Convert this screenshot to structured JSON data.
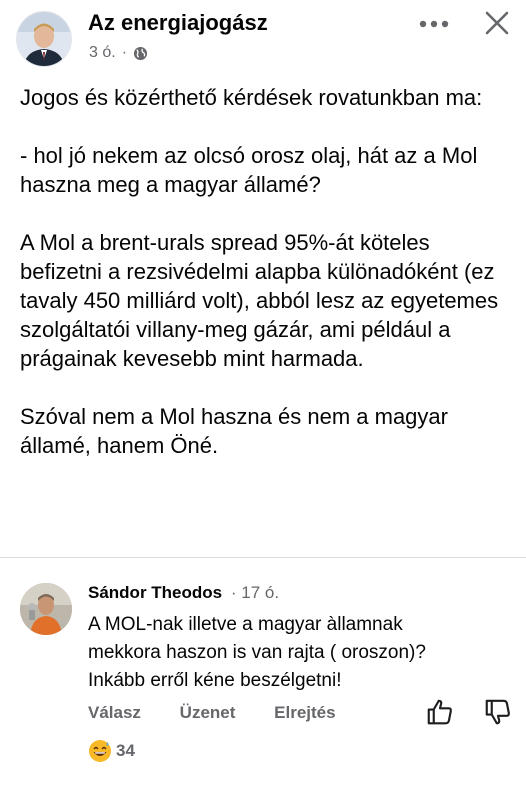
{
  "post": {
    "author": "Az energiajogász",
    "time": "3 ó.",
    "separator": "·",
    "privacy_icon": "globe-icon",
    "paragraphs": [
      "Jogos és közérthető kérdések rovatunkban ma:",
      "- hol jó nekem az olcsó orosz olaj, hát az a Mol haszna meg a magyar államé?",
      "A Mol a brent-urals spread 95%-át köteles befizetni a rezsivédelmi alapba különadóként (ez tavaly 450 milliárd volt), abból lesz az egyetemes szolgáltatói villany-meg gázár, ami például a prágainak kevesebb mint harmada.",
      "Szóval nem a Mol haszna és nem a magyar államé, hanem Öné."
    ]
  },
  "header_icons": {
    "more": "more-icon",
    "close": "close-icon"
  },
  "comment": {
    "author": "Sándor Theodos",
    "time": "· 17 ó.",
    "text": "A MOL-nak illetve a magyar àllamnak\nmekkora haszon is van rajta ( oroszon)?\nInkább erről kéne beszélgetni!",
    "actions": {
      "reply": "Válasz",
      "message": "Üzenet",
      "hide": "Elrejtés"
    },
    "reaction_emoji": "grinning-sweat-emoji",
    "reaction_count": "34"
  },
  "colors": {
    "text": "#050505",
    "meta": "#65676b",
    "divider": "#dadde1",
    "emoji": "#f7b928"
  }
}
